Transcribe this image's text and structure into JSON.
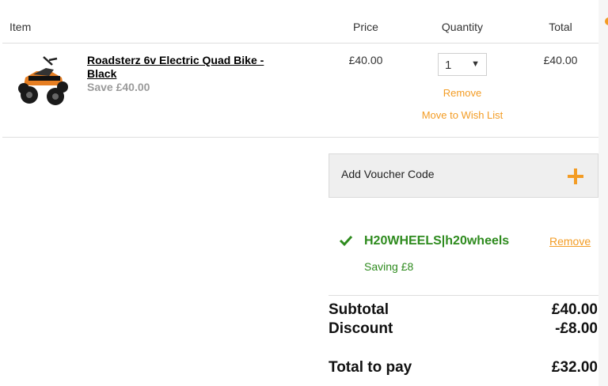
{
  "table_header": {
    "item": "Item",
    "price": "Price",
    "quantity": "Quantity",
    "total": "Total"
  },
  "product": {
    "name": "Roadsterz 6v Electric Quad Bike - Black",
    "save": "Save £40.00",
    "price": "£40.00",
    "quantity": "1",
    "total": "£40.00",
    "remove": "Remove",
    "move_to_wishlist": "Move to Wish List"
  },
  "voucher": {
    "label": "Add Voucher Code"
  },
  "applied_code": {
    "code": "H20WHEELS|h20wheels",
    "remove": "Remove",
    "saving": "Saving £8"
  },
  "summary": {
    "subtotal_label": "Subtotal",
    "subtotal_value": "£40.00",
    "discount_label": "Discount",
    "discount_value": "-£8.00",
    "total_label": "Total to pay",
    "total_value": "£32.00"
  },
  "colors": {
    "accent": "#f39c24",
    "success": "#2e8b1e",
    "muted": "#9a9a9a"
  }
}
